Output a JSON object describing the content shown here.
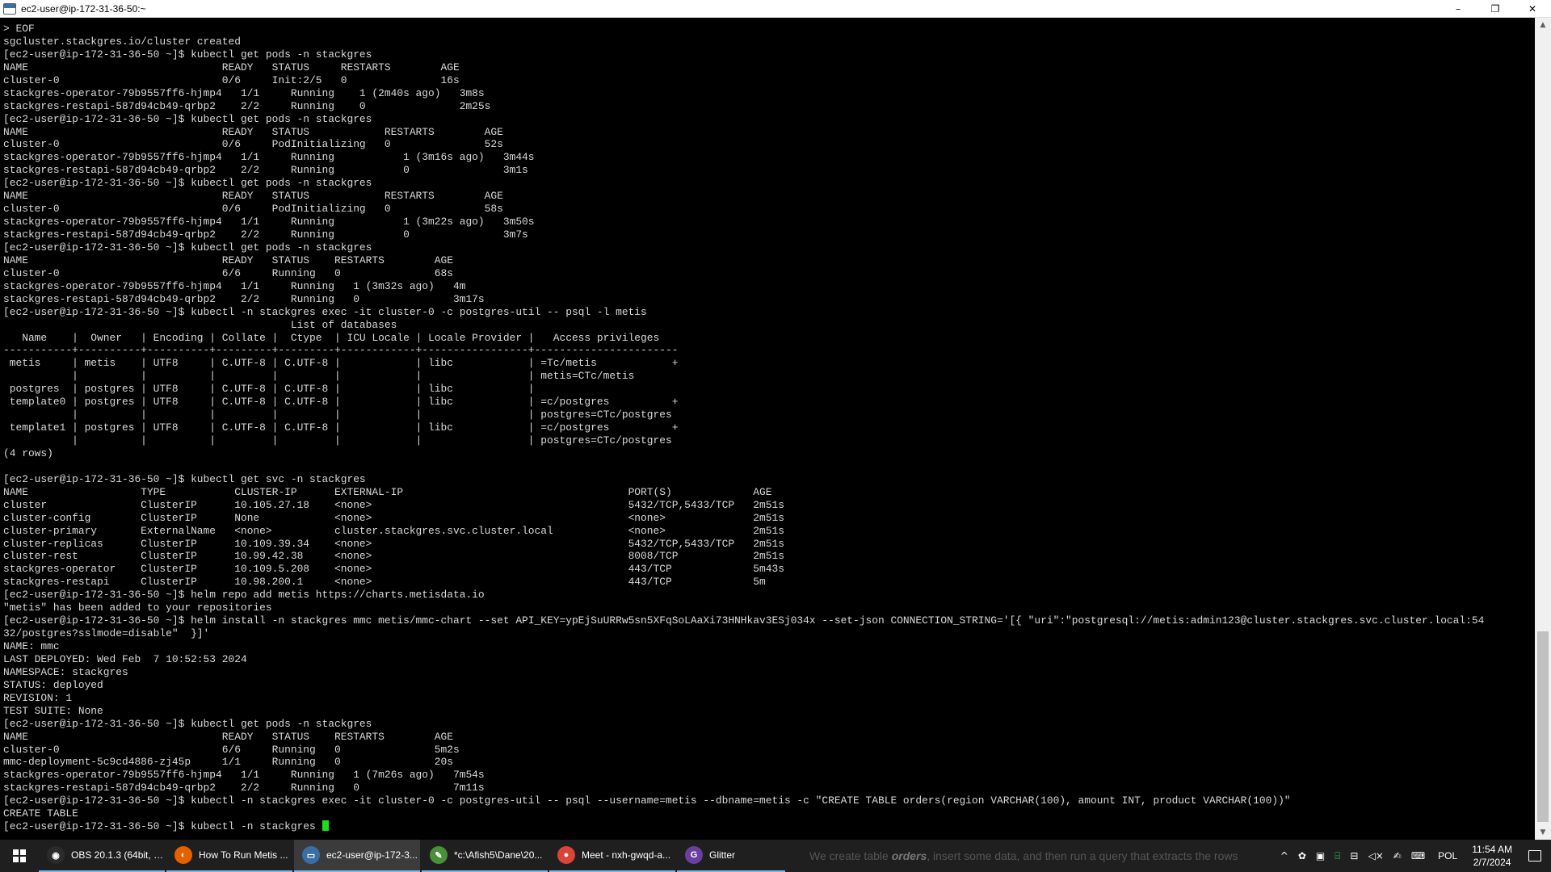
{
  "window": {
    "title": "ec2-user@ip-172-31-36-50:~",
    "minimize": "–",
    "restore": "❐",
    "close": "✕"
  },
  "terminal": {
    "lines": [
      "> EOF",
      "sgcluster.stackgres.io/cluster created",
      "[ec2-user@ip-172-31-36-50 ~]$ kubectl get pods -n stackgres",
      "NAME                               READY   STATUS     RESTARTS        AGE",
      "cluster-0                          0/6     Init:2/5   0               16s",
      "stackgres-operator-79b9557ff6-hjmp4   1/1     Running    1 (2m40s ago)   3m8s",
      "stackgres-restapi-587d94cb49-qrbp2    2/2     Running    0               2m25s",
      "[ec2-user@ip-172-31-36-50 ~]$ kubectl get pods -n stackgres",
      "NAME                               READY   STATUS            RESTARTS        AGE",
      "cluster-0                          0/6     PodInitializing   0               52s",
      "stackgres-operator-79b9557ff6-hjmp4   1/1     Running           1 (3m16s ago)   3m44s",
      "stackgres-restapi-587d94cb49-qrbp2    2/2     Running           0               3m1s",
      "[ec2-user@ip-172-31-36-50 ~]$ kubectl get pods -n stackgres",
      "NAME                               READY   STATUS            RESTARTS        AGE",
      "cluster-0                          0/6     PodInitializing   0               58s",
      "stackgres-operator-79b9557ff6-hjmp4   1/1     Running           1 (3m22s ago)   3m50s",
      "stackgres-restapi-587d94cb49-qrbp2    2/2     Running           0               3m7s",
      "[ec2-user@ip-172-31-36-50 ~]$ kubectl get pods -n stackgres",
      "NAME                               READY   STATUS    RESTARTS        AGE",
      "cluster-0                          6/6     Running   0               68s",
      "stackgres-operator-79b9557ff6-hjmp4   1/1     Running   1 (3m32s ago)   4m",
      "stackgres-restapi-587d94cb49-qrbp2    2/2     Running   0               3m17s",
      "[ec2-user@ip-172-31-36-50 ~]$ kubectl -n stackgres exec -it cluster-0 -c postgres-util -- psql -l metis",
      "                                              List of databases",
      "   Name    |  Owner   | Encoding | Collate |  Ctype  | ICU Locale | Locale Provider |   Access privileges",
      "-----------+----------+----------+---------+---------+------------+-----------------+-----------------------",
      " metis     | metis    | UTF8     | C.UTF-8 | C.UTF-8 |            | libc            | =Tc/metis            +",
      "           |          |          |         |         |            |                 | metis=CTc/metis",
      " postgres  | postgres | UTF8     | C.UTF-8 | C.UTF-8 |            | libc            |",
      " template0 | postgres | UTF8     | C.UTF-8 | C.UTF-8 |            | libc            | =c/postgres          +",
      "           |          |          |         |         |            |                 | postgres=CTc/postgres",
      " template1 | postgres | UTF8     | C.UTF-8 | C.UTF-8 |            | libc            | =c/postgres          +",
      "           |          |          |         |         |            |                 | postgres=CTc/postgres",
      "(4 rows)",
      "",
      "[ec2-user@ip-172-31-36-50 ~]$ kubectl get svc -n stackgres",
      "NAME                  TYPE           CLUSTER-IP      EXTERNAL-IP                                    PORT(S)             AGE",
      "cluster               ClusterIP      10.105.27.18    <none>                                         5432/TCP,5433/TCP   2m51s",
      "cluster-config        ClusterIP      None            <none>                                         <none>              2m51s",
      "cluster-primary       ExternalName   <none>          cluster.stackgres.svc.cluster.local            <none>              2m51s",
      "cluster-replicas      ClusterIP      10.109.39.34    <none>                                         5432/TCP,5433/TCP   2m51s",
      "cluster-rest          ClusterIP      10.99.42.38     <none>                                         8008/TCP            2m51s",
      "stackgres-operator    ClusterIP      10.109.5.208    <none>                                         443/TCP             5m43s",
      "stackgres-restapi     ClusterIP      10.98.200.1     <none>                                         443/TCP             5m",
      "[ec2-user@ip-172-31-36-50 ~]$ helm repo add metis https://charts.metisdata.io",
      "\"metis\" has been added to your repositories",
      "[ec2-user@ip-172-31-36-50 ~]$ helm install -n stackgres mmc metis/mmc-chart --set API_KEY=ypEjSuURRw5sn5XFqSoLAaXi73HNHkav3ESj034x --set-json CONNECTION_STRING='[{ \"uri\":\"postgresql://metis:admin123@cluster.stackgres.svc.cluster.local:54",
      "32/postgres?sslmode=disable\"  }]'",
      "NAME: mmc",
      "LAST DEPLOYED: Wed Feb  7 10:52:53 2024",
      "NAMESPACE: stackgres",
      "STATUS: deployed",
      "REVISION: 1",
      "TEST SUITE: None",
      "[ec2-user@ip-172-31-36-50 ~]$ kubectl get pods -n stackgres",
      "NAME                               READY   STATUS    RESTARTS        AGE",
      "cluster-0                          6/6     Running   0               5m2s",
      "mmc-deployment-5c9cd4886-zj45p     1/1     Running   0               20s",
      "stackgres-operator-79b9557ff6-hjmp4   1/1     Running   1 (7m26s ago)   7m54s",
      "stackgres-restapi-587d94cb49-qrbp2    2/2     Running   0               7m11s",
      "[ec2-user@ip-172-31-36-50 ~]$ kubectl -n stackgres exec -it cluster-0 -c postgres-util -- psql --username=metis --dbname=metis -c \"CREATE TABLE orders(region VARCHAR(100), amount INT, product VARCHAR(100))\"",
      "CREATE TABLE"
    ],
    "current_prompt": "[ec2-user@ip-172-31-36-50 ~]$ kubectl -n stackgres "
  },
  "scrollbar": {
    "up": "▲",
    "down": "▼"
  },
  "taskbar": {
    "tasks": [
      {
        "label": "OBS 20.1.3 (64bit, w...",
        "icon": "obs-icon",
        "icon_color": "#2b2b2b",
        "glyph": "◉"
      },
      {
        "label": "How To Run Metis ...",
        "icon": "firefox-icon",
        "icon_color": "#e66000",
        "glyph": "◐"
      },
      {
        "label": "ec2-user@ip-172-3...",
        "icon": "putty-icon",
        "icon_color": "#3a6ea5",
        "glyph": "▭"
      },
      {
        "label": "*c:\\Afish5\\Dane\\20...",
        "icon": "notepad-icon",
        "icon_color": "#4a8f3a",
        "glyph": "✎"
      },
      {
        "label": "Meet - nxh-gwqd-a...",
        "icon": "chrome-icon",
        "icon_color": "#db4437",
        "glyph": "●"
      },
      {
        "label": "Glitter",
        "icon": "glitter-icon",
        "icon_color": "#6b3fa0",
        "glyph": "G"
      }
    ],
    "caption_prefix": "We create table ",
    "caption_bold": "orders",
    "caption_suffix": ", insert some data, and then run a query that extracts the rows",
    "tray": {
      "chevron": "^",
      "lang": "POL",
      "time": "11:54 AM",
      "date": "2/7/2024"
    }
  }
}
